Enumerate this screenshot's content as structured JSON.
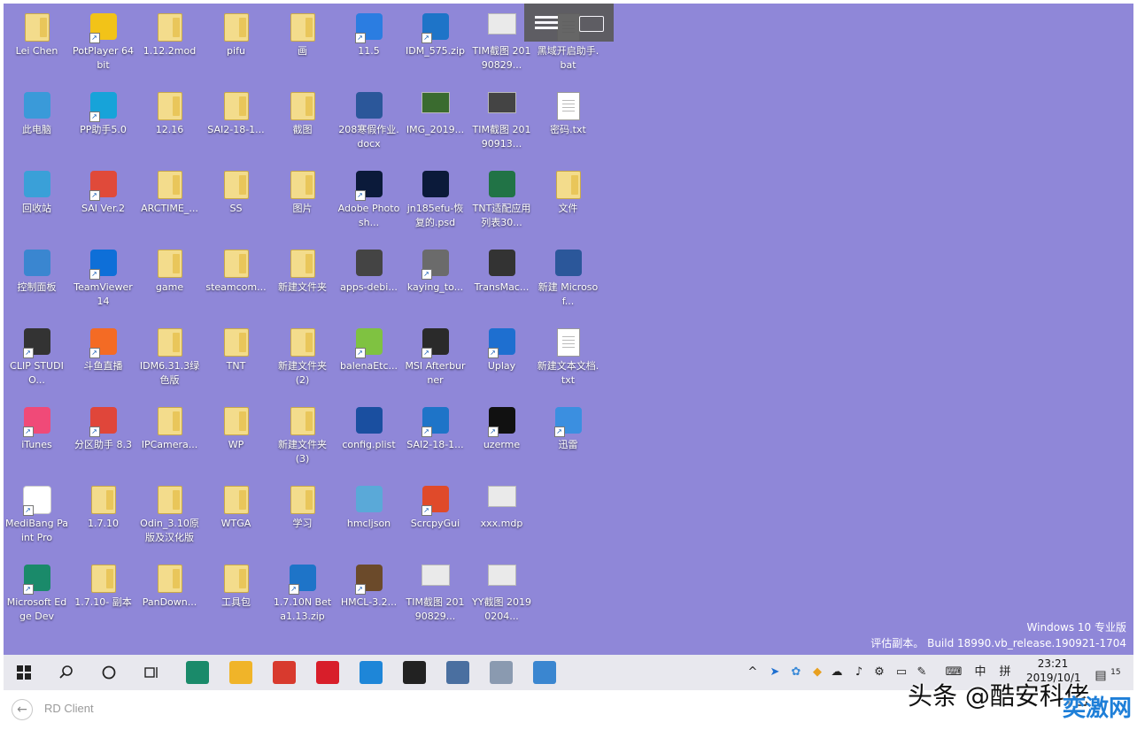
{
  "desktop": {
    "icons": [
      {
        "label": "Lei Chen",
        "icon": "user-folder-icon",
        "color": "#f3dc8c"
      },
      {
        "label": "PotPlayer 64 bit",
        "icon": "potplayer-icon",
        "color": "#f2c318"
      },
      {
        "label": "1.12.2mod",
        "icon": "folder-icon"
      },
      {
        "label": "pifu",
        "icon": "folder-icon"
      },
      {
        "label": "画",
        "icon": "folder-icon"
      },
      {
        "label": "11.5",
        "icon": "app-5-icon",
        "color": "#2b7de1"
      },
      {
        "label": "IDM_575.zip",
        "icon": "zip-icon",
        "color": "#1e74c8"
      },
      {
        "label": "TIM截图 20190829...",
        "icon": "image-icon"
      },
      {
        "label": "黑域开启助手.bat",
        "icon": "batch-file-icon"
      },
      {
        "label": "此电脑",
        "icon": "computer-icon",
        "color": "#3a9ad9"
      },
      {
        "label": "PP助手5.0",
        "icon": "pp-assistant-icon",
        "color": "#17a3d9"
      },
      {
        "label": "12.16",
        "icon": "folder-icon"
      },
      {
        "label": "SAI2-18-1...",
        "icon": "folder-icon"
      },
      {
        "label": "截图",
        "icon": "folder-icon"
      },
      {
        "label": "208寒假作业.docx",
        "icon": "word-doc-icon",
        "color": "#2b579a"
      },
      {
        "label": "IMG_2019...",
        "icon": "image-icon",
        "color": "#3a6b2f"
      },
      {
        "label": "TIM截图 20190913...",
        "icon": "image-icon",
        "color": "#444444"
      },
      {
        "label": "密码.txt",
        "icon": "text-file-icon"
      },
      {
        "label": "回收站",
        "icon": "recycle-bin-icon",
        "color": "#3aa0d8"
      },
      {
        "label": "SAI Ver.2",
        "icon": "sai-icon",
        "color": "#e04a3a"
      },
      {
        "label": "ARCTIME_...",
        "icon": "folder-icon"
      },
      {
        "label": "SS",
        "icon": "folder-icon"
      },
      {
        "label": "图片",
        "icon": "folder-icon"
      },
      {
        "label": "Adobe Photosh...",
        "icon": "photoshop-icon",
        "color": "#0b1a3a"
      },
      {
        "label": "jn185efu-恢复的.psd",
        "icon": "psd-file-icon",
        "color": "#0b1a3a"
      },
      {
        "label": "TNT适配应用列表30...",
        "icon": "excel-icon",
        "color": "#217346"
      },
      {
        "label": "文件",
        "icon": "folder-icon"
      },
      {
        "label": "控制面板",
        "icon": "control-panel-icon",
        "color": "#3a86d0"
      },
      {
        "label": "TeamViewer 14",
        "icon": "teamviewer-icon",
        "color": "#0e6fd8"
      },
      {
        "label": "game",
        "icon": "folder-icon"
      },
      {
        "label": "steamcom...",
        "icon": "folder-icon"
      },
      {
        "label": "新建文件夹",
        "icon": "folder-icon"
      },
      {
        "label": "apps-debi...",
        "icon": "gz-archive-icon",
        "color": "#444444"
      },
      {
        "label": "kaying_to...",
        "icon": "shield-app-icon",
        "color": "#6b6b6b"
      },
      {
        "label": "TransMac...",
        "icon": "transmac-icon",
        "color": "#333333"
      },
      {
        "label": "新建 Microsof...",
        "icon": "word-doc-icon",
        "color": "#2b579a"
      },
      {
        "label": "CLIP STUDIO...",
        "icon": "clip-studio-icon",
        "color": "#333333"
      },
      {
        "label": "斗鱼直播",
        "icon": "douyu-icon",
        "color": "#f46b24"
      },
      {
        "label": "IDM6.31.3绿色版",
        "icon": "folder-icon"
      },
      {
        "label": "TNT",
        "icon": "folder-icon"
      },
      {
        "label": "新建文件夹 (2)",
        "icon": "folder-icon"
      },
      {
        "label": "balenaEtc...",
        "icon": "balena-etcher-icon",
        "color": "#7fc241"
      },
      {
        "label": "MSI Afterburner",
        "icon": "msi-afterburner-icon",
        "color": "#2a2a2a"
      },
      {
        "label": "Uplay",
        "icon": "uplay-icon",
        "color": "#1e6fd0"
      },
      {
        "label": "新建文本文档.txt",
        "icon": "text-file-icon"
      },
      {
        "label": "iTunes",
        "icon": "itunes-icon",
        "color": "#f04a78"
      },
      {
        "label": "分区助手 8.3",
        "icon": "partition-assistant-icon",
        "color": "#e0463a"
      },
      {
        "label": "IPCamera...",
        "icon": "folder-icon"
      },
      {
        "label": "WP",
        "icon": "folder-icon"
      },
      {
        "label": "新建文件夹 (3)",
        "icon": "folder-icon"
      },
      {
        "label": "config.plist",
        "icon": "plist-file-icon",
        "color": "#1a4fa0"
      },
      {
        "label": "SAI2-18-1...",
        "icon": "zip-icon",
        "color": "#1e74c8"
      },
      {
        "label": "uzerme",
        "icon": "uzerme-icon",
        "color": "#111111"
      },
      {
        "label": "迅雷",
        "icon": "xunlei-icon",
        "color": "#3b8fe0"
      },
      {
        "label": "MediBang Paint Pro",
        "icon": "medibang-icon",
        "color": "#ffffff"
      },
      {
        "label": "1.7.10",
        "icon": "folder-icon"
      },
      {
        "label": "Odin_3.10原版及汉化版",
        "icon": "folder-icon"
      },
      {
        "label": "WTGA",
        "icon": "folder-icon"
      },
      {
        "label": "学习",
        "icon": "folder-icon"
      },
      {
        "label": "hmcljson",
        "icon": "notepad-icon",
        "color": "#5aa9d8"
      },
      {
        "label": "ScrcpyGui",
        "icon": "scrcpy-icon",
        "color": "#e04a2a"
      },
      {
        "label": "xxx.mdp",
        "icon": "image-icon"
      },
      {
        "label": "Microsoft Edge Dev",
        "icon": "edge-dev-icon",
        "color": "#1a8a6a"
      },
      {
        "label": "1.7.10- 副本",
        "icon": "folder-icon"
      },
      {
        "label": "PanDown...",
        "icon": "folder-icon"
      },
      {
        "label": "工具包",
        "icon": "folder-icon"
      },
      {
        "label": "1.7.10N Beta1.13.zip",
        "icon": "zip-icon",
        "color": "#1e74c8"
      },
      {
        "label": "HMCL-3.2...",
        "icon": "minecraft-icon",
        "color": "#6b4a2a"
      },
      {
        "label": "TIM截图 20190829...",
        "icon": "image-icon"
      },
      {
        "label": "YY截图 20190204...",
        "icon": "image-icon"
      }
    ]
  },
  "watermark": {
    "line1": "Windows 10 专业版",
    "line2": "评估副本。 Build 18990.vb_release.190921-1704"
  },
  "taskbar": {
    "start_icon": "windows-start-icon",
    "apps": [
      {
        "name": "edge-dev-taskbar-icon",
        "color": "#1a8a6a"
      },
      {
        "name": "file-explorer-icon",
        "color": "#f0b429"
      },
      {
        "name": "app-red-icon",
        "color": "#d83a2e"
      },
      {
        "name": "netease-music-icon",
        "color": "#d81e2a"
      },
      {
        "name": "app-blue-star-icon",
        "color": "#1e86d8"
      },
      {
        "name": "obs-icon",
        "color": "#222222"
      },
      {
        "name": "network-app-icon",
        "color": "#4a6fa0"
      },
      {
        "name": "monitor-app-icon",
        "color": "#8a9ab0"
      },
      {
        "name": "control-panel-taskbar-icon",
        "color": "#3a86d0"
      }
    ],
    "ime_lang": "中",
    "ime_mode": "拼",
    "clock_time": "23:21",
    "clock_date": "2019/10/1",
    "notification_count": "15"
  },
  "remote_client": {
    "title": "RD Client"
  },
  "overlay": {
    "source": "头条 @酷安科佬",
    "site": "奕激网"
  }
}
